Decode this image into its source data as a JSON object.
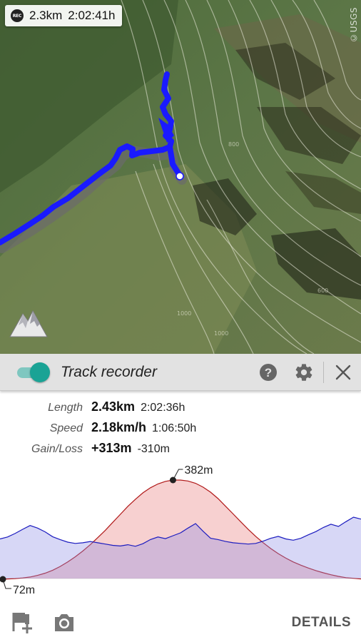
{
  "recording": {
    "distance": "2.3km",
    "duration": "2:02:41h",
    "rec_badge": "REC"
  },
  "map": {
    "attribution": "©USGS",
    "track_color": "#1a1aff"
  },
  "toolbar": {
    "title": "Track recorder",
    "toggle_on": true,
    "accent_color": "#1aa395",
    "icons": [
      "help-icon",
      "gear-icon",
      "close-icon"
    ]
  },
  "stats": {
    "length": {
      "label": "Length",
      "value": "2.43km",
      "time": "2:02:36h"
    },
    "speed": {
      "label": "Speed",
      "value": "2.18km/h",
      "time": "1:06:50h"
    },
    "gainloss": {
      "label": "Gain/Loss",
      "value": "+313m",
      "loss": "-310m"
    }
  },
  "chart_data": {
    "type": "area",
    "series": [
      {
        "values": [
          72,
          73,
          74,
          76,
          79,
          84,
          91,
          100,
          112,
          126,
          142,
          160,
          180,
          202,
          225,
          250,
          275,
          300,
          322,
          342,
          358,
          370,
          378,
          382,
          382,
          379,
          372,
          360,
          344,
          324,
          300,
          276,
          252,
          228,
          206,
          186,
          168,
          152,
          138,
          126,
          116,
          107,
          99,
          92,
          86,
          81,
          77,
          75,
          73
        ]
      },
      {
        "values": [
          198,
          204,
          215,
          228,
          240,
          232,
          220,
          205,
          196,
          188,
          184,
          186,
          190,
          186,
          182,
          178,
          176,
          180,
          175,
          183,
          196,
          204,
          199,
          208,
          217,
          232,
          246,
          222,
          200,
          196,
          190,
          186,
          184,
          182,
          184,
          191,
          200,
          206,
          198,
          194,
          200,
          211,
          221,
          234,
          244,
          237,
          252,
          266,
          260
        ]
      }
    ],
    "annotations": [
      "382m",
      "72m"
    ]
  },
  "bottom": {
    "details_label": "DETAILS",
    "icons": [
      "add-flag-icon",
      "camera-icon"
    ]
  }
}
